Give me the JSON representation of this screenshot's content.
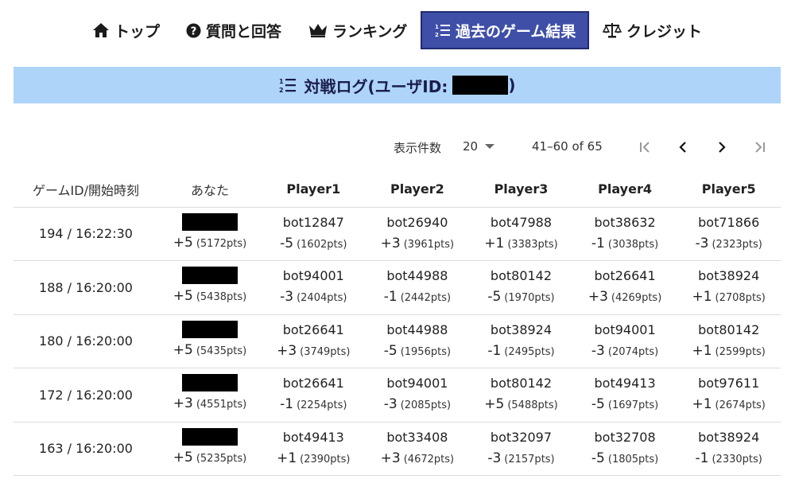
{
  "nav": {
    "items": [
      {
        "label": "トップ",
        "icon": "home-icon"
      },
      {
        "label": "質問と回答",
        "icon": "question-circle-icon"
      },
      {
        "label": "ランキング",
        "icon": "crown-icon"
      },
      {
        "label": "過去のゲーム結果",
        "icon": "list-ol-icon",
        "active": true
      },
      {
        "label": "クレジット",
        "icon": "balance-scale-icon"
      }
    ],
    "active_bg": "#3f4fa8"
  },
  "banner": {
    "title_prefix": "対戦ログ(ユーザID:",
    "title_suffix": ")",
    "bg": "#aed4f9"
  },
  "pager": {
    "rows_per_page_label": "表示件数",
    "rows_per_page_value": "20",
    "range": "41–60 of 65"
  },
  "table": {
    "headers": [
      "ゲームID/開始時刻",
      "あなた",
      "Player1",
      "Player2",
      "Player3",
      "Player4",
      "Player5"
    ],
    "rows": [
      {
        "game": "194 / 16:22:30",
        "you": {
          "score": "+5",
          "pts": "(5172pts)"
        },
        "players": [
          {
            "name": "bot12847",
            "score": "-5",
            "pts": "(1602pts)"
          },
          {
            "name": "bot26940",
            "score": "+3",
            "pts": "(3961pts)"
          },
          {
            "name": "bot47988",
            "score": "+1",
            "pts": "(3383pts)"
          },
          {
            "name": "bot38632",
            "score": "-1",
            "pts": "(3038pts)"
          },
          {
            "name": "bot71866",
            "score": "-3",
            "pts": "(2323pts)"
          }
        ]
      },
      {
        "game": "188 / 16:20:00",
        "you": {
          "score": "+5",
          "pts": "(5438pts)"
        },
        "players": [
          {
            "name": "bot94001",
            "score": "-3",
            "pts": "(2404pts)"
          },
          {
            "name": "bot44988",
            "score": "-1",
            "pts": "(2442pts)"
          },
          {
            "name": "bot80142",
            "score": "-5",
            "pts": "(1970pts)"
          },
          {
            "name": "bot26641",
            "score": "+3",
            "pts": "(4269pts)"
          },
          {
            "name": "bot38924",
            "score": "+1",
            "pts": "(2708pts)"
          }
        ]
      },
      {
        "game": "180 / 16:20:00",
        "you": {
          "score": "+5",
          "pts": "(5435pts)"
        },
        "players": [
          {
            "name": "bot26641",
            "score": "+3",
            "pts": "(3749pts)"
          },
          {
            "name": "bot44988",
            "score": "-5",
            "pts": "(1956pts)"
          },
          {
            "name": "bot38924",
            "score": "-1",
            "pts": "(2495pts)"
          },
          {
            "name": "bot94001",
            "score": "-3",
            "pts": "(2074pts)"
          },
          {
            "name": "bot80142",
            "score": "+1",
            "pts": "(2599pts)"
          }
        ]
      },
      {
        "game": "172 / 16:20:00",
        "you": {
          "score": "+3",
          "pts": "(4551pts)"
        },
        "players": [
          {
            "name": "bot26641",
            "score": "-1",
            "pts": "(2254pts)"
          },
          {
            "name": "bot94001",
            "score": "-3",
            "pts": "(2085pts)"
          },
          {
            "name": "bot80142",
            "score": "+5",
            "pts": "(5488pts)"
          },
          {
            "name": "bot49413",
            "score": "-5",
            "pts": "(1697pts)"
          },
          {
            "name": "bot97611",
            "score": "+1",
            "pts": "(2674pts)"
          }
        ]
      },
      {
        "game": "163 / 16:20:00",
        "you": {
          "score": "+5",
          "pts": "(5235pts)"
        },
        "players": [
          {
            "name": "bot49413",
            "score": "+1",
            "pts": "(2390pts)"
          },
          {
            "name": "bot33408",
            "score": "+3",
            "pts": "(4672pts)"
          },
          {
            "name": "bot32097",
            "score": "-3",
            "pts": "(2157pts)"
          },
          {
            "name": "bot32708",
            "score": "-5",
            "pts": "(1805pts)"
          },
          {
            "name": "bot38924",
            "score": "-1",
            "pts": "(2330pts)"
          }
        ]
      }
    ]
  }
}
